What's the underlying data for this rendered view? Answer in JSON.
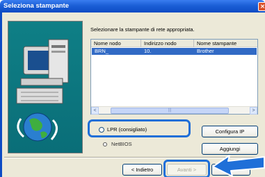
{
  "window": {
    "title": "Seleziona stampante",
    "close_glyph": "✕"
  },
  "instruction": "Selezionare la stampante di rete appropriata.",
  "table": {
    "columns": [
      "Nome nodo",
      "Indirizzo nodo",
      "Nome stampante"
    ],
    "rows": [
      {
        "node_name": "BRN_",
        "node_address": "10.",
        "printer_name": "Brother",
        "selected": true
      }
    ],
    "scroll_left_glyph": "<",
    "scroll_right_glyph": ">",
    "scroll_thumb_glyph": "|||"
  },
  "protocol": {
    "lpr_label": "LPR (consigliato)",
    "netbios_label": "NetBIOS"
  },
  "buttons": {
    "configure_ip": "Configura IP",
    "add": "Aggiungi",
    "back": "< Indietro",
    "next": "Avanti >",
    "cancel": ""
  },
  "colors": {
    "title_bar": "#1b5fd6",
    "selection": "#316ac5",
    "annotation_blue": "#1f6fd8",
    "wizard_panel": "#0f7f86"
  },
  "icons": {
    "wizard_art": "computer-printer-globe-illustration",
    "pointer": "blue-arrow-icon"
  }
}
